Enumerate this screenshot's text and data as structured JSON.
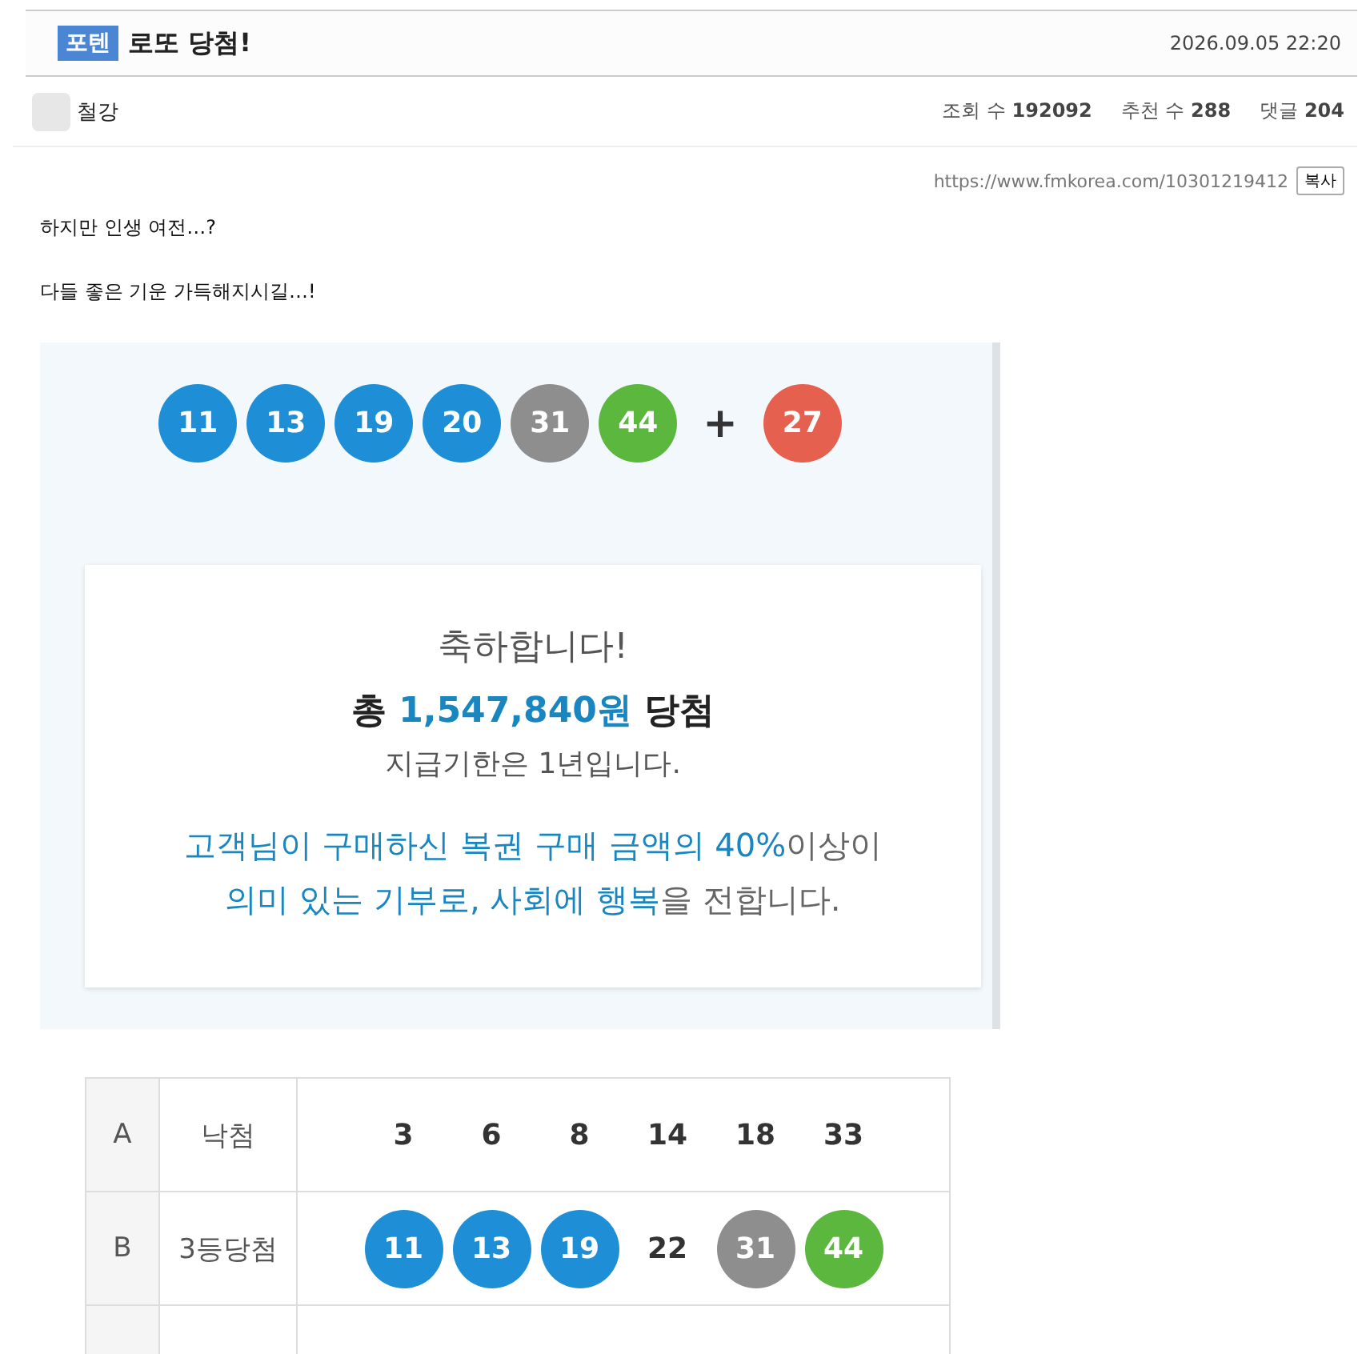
{
  "post": {
    "category": "포텐",
    "title": "로또 당첨!",
    "date": "2026.09.05 22:20"
  },
  "author": {
    "name": "철강"
  },
  "stats": [
    {
      "label": "조회 수",
      "value": "192092"
    },
    {
      "label": "추천 수",
      "value": "288"
    },
    {
      "label": "댓글",
      "value": "204"
    }
  ],
  "link": {
    "url": "https://www.fmkorea.com/10301219412",
    "copy_button": "복사"
  },
  "paragraphs": [
    "하지만 인생 여전…?",
    "다들 좋은 기운 가득해지시길…!"
  ],
  "lotto": {
    "winning_numbers": [
      {
        "number": "11",
        "color": "#1e8fd6"
      },
      {
        "number": "13",
        "color": "#1e8fd6"
      },
      {
        "number": "19",
        "color": "#1e8fd6"
      },
      {
        "number": "20",
        "color": "#1e8fd6"
      },
      {
        "number": "31",
        "color": "#8e8e8e"
      },
      {
        "number": "44",
        "color": "#5cb73f"
      }
    ],
    "plus": "+",
    "bonus_number": {
      "number": "27",
      "color": "#e6604f"
    },
    "card": {
      "heading": "축하합니다!",
      "prize": [
        {
          "text": "총 ",
          "highlight": false
        },
        {
          "text": "1,547,840원",
          "highlight": true
        },
        {
          "text": " 당첨",
          "highlight": false
        }
      ],
      "deadline": "지급기한은 1년입니다.",
      "message": [
        [
          {
            "text": "고객님이 구매하신 복권 구매 금액의 40%",
            "highlight": true
          },
          {
            "text": "이상이",
            "highlight": false
          }
        ],
        [
          {
            "text": "의미 있는 기부로, 사회에 행복",
            "highlight": true
          },
          {
            "text": "을 전합니다.",
            "highlight": false
          }
        ]
      ]
    },
    "games": [
      {
        "slot": "A",
        "result": "낙첨",
        "numbers": [
          {
            "kind": "plain",
            "number": "3"
          },
          {
            "kind": "plain",
            "number": "6"
          },
          {
            "kind": "plain",
            "number": "8"
          },
          {
            "kind": "plain",
            "number": "14"
          },
          {
            "kind": "plain",
            "number": "18"
          },
          {
            "kind": "plain",
            "number": "33"
          }
        ]
      },
      {
        "slot": "B",
        "result": "3등당첨",
        "numbers": [
          {
            "kind": "ball",
            "number": "11",
            "color": "#1e8fd6"
          },
          {
            "kind": "ball",
            "number": "13",
            "color": "#1e8fd6"
          },
          {
            "kind": "ball",
            "number": "19",
            "color": "#1e8fd6"
          },
          {
            "kind": "plain",
            "number": "22"
          },
          {
            "kind": "ball",
            "number": "31",
            "color": "#8e8e8e"
          },
          {
            "kind": "ball",
            "number": "44",
            "color": "#5cb73f"
          }
        ]
      }
    ]
  }
}
